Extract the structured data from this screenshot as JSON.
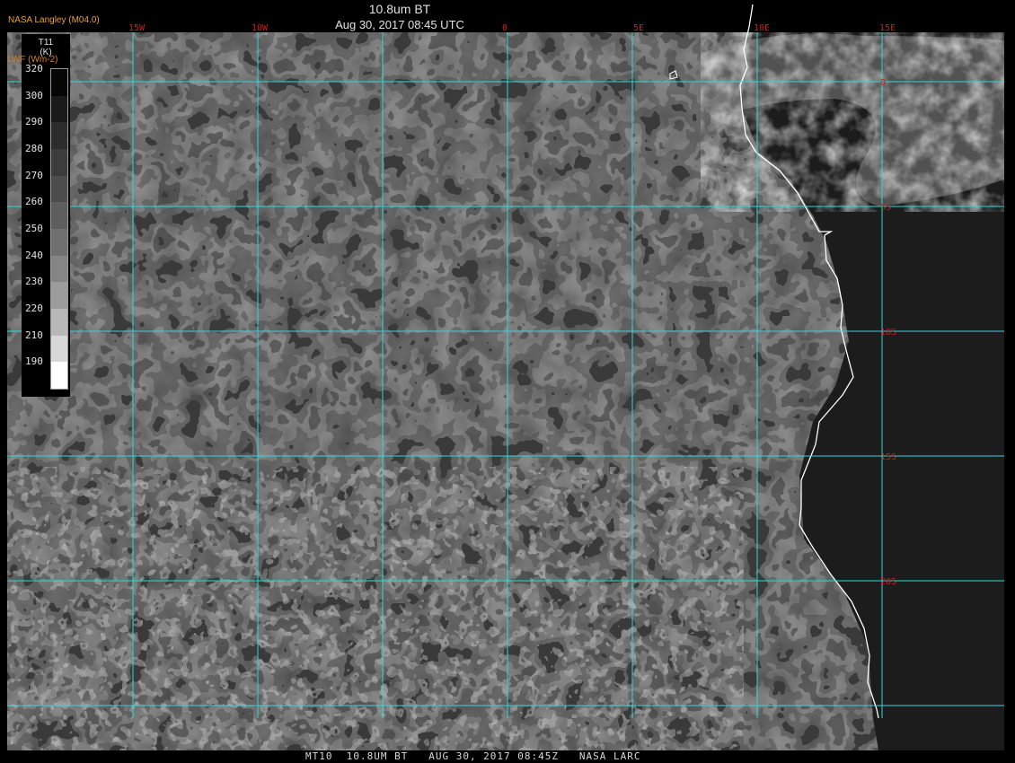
{
  "header": {
    "product": "10.8um BT",
    "datetime": "Aug 30, 2017 08:45 UTC",
    "brand": "NASA Langley (M04.0)",
    "legend_sub": "LWF (Wm-2)"
  },
  "legend": {
    "title_line1": "T11",
    "title_line2": "(K)",
    "labels": [
      "320",
      "300",
      "290",
      "280",
      "270",
      "260",
      "250",
      "240",
      "230",
      "220",
      "210",
      "190"
    ],
    "colors": [
      "#060606",
      "#1a1a1a",
      "#2c2c2c",
      "#3c3c3c",
      "#4c4c4c",
      "#5e5e5e",
      "#707070",
      "#858585",
      "#9c9c9c",
      "#b8b8b8",
      "#d8d8d8",
      "#ffffff"
    ]
  },
  "grid": {
    "lon_labels": [
      "15W",
      "10W",
      "0",
      "5E",
      "10E",
      "15E"
    ],
    "lat_labels": [
      "0",
      "5S",
      "10S",
      "15S",
      "20S"
    ],
    "line_color": "#33d6d6",
    "label_color": "#cc2020",
    "coast_color": "#ffffff"
  },
  "footer": {
    "text": "MT10  10.8UM BT   AUG 30, 2017 08:45Z   NASA LARC"
  }
}
